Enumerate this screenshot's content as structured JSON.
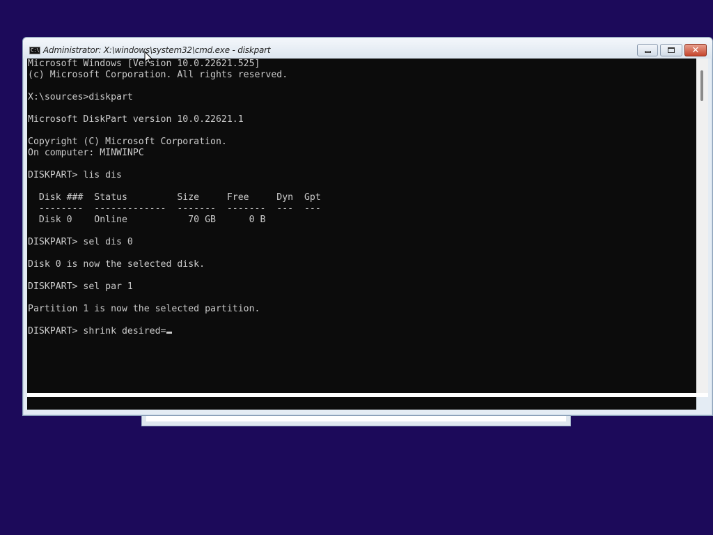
{
  "window": {
    "title": "Administrator: X:\\windows\\system32\\cmd.exe - diskpart",
    "title_icon_text": "C:\\",
    "buttons": {
      "minimize": "minimize",
      "maximize": "maximize",
      "close": "✕"
    }
  },
  "console": {
    "lines": [
      "Microsoft Windows [Version 10.0.22621.525]",
      "(c) Microsoft Corporation. All rights reserved.",
      "",
      "X:\\sources>diskpart",
      "",
      "Microsoft DiskPart version 10.0.22621.1",
      "",
      "Copyright (C) Microsoft Corporation.",
      "On computer: MINWINPC",
      "",
      "DISKPART> lis dis",
      "",
      "  Disk ###  Status         Size     Free     Dyn  Gpt",
      "  --------  -------------  -------  -------  ---  ---",
      "  Disk 0    Online           70 GB      0 B",
      "",
      "DISKPART> sel dis 0",
      "",
      "Disk 0 is now the selected disk.",
      "",
      "DISKPART> sel par 1",
      "",
      "Partition 1 is now the selected partition.",
      ""
    ],
    "current_input": "DISKPART> shrink desired="
  },
  "colors": {
    "desktop_background": "#1c0a5a",
    "console_background": "#0c0c0c",
    "console_text": "#cccccc",
    "close_button": "#c5452c"
  },
  "icons": [
    "cmd-icon",
    "minimize-icon",
    "maximize-icon",
    "close-icon",
    "mouse-pointer-icon"
  ]
}
